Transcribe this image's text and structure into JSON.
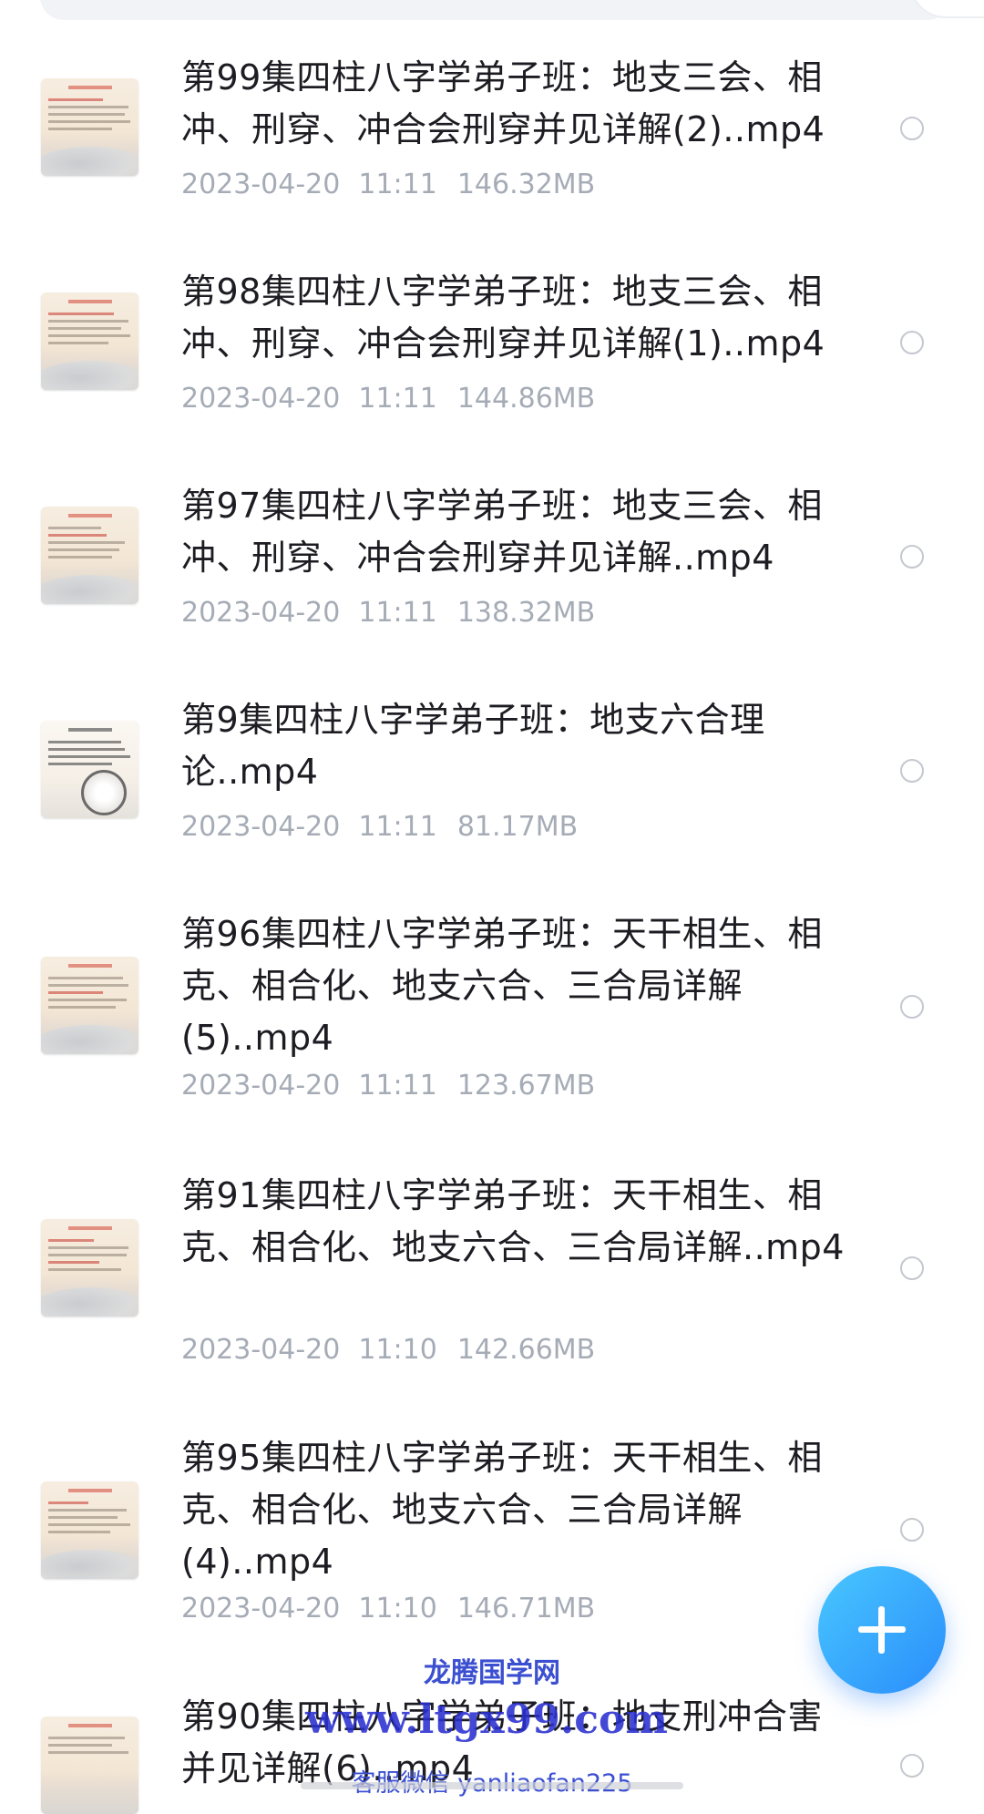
{
  "files": [
    {
      "title": "第99集四柱八字学弟子班：地支三会、相冲、刑穿、冲合会刑穿并见详解(2)..mp4",
      "date": "2023-04-20",
      "time": "11:11",
      "size": "146.32MB"
    },
    {
      "title": "第98集四柱八字学弟子班：地支三会、相冲、刑穿、冲合会刑穿并见详解(1)..mp4",
      "date": "2023-04-20",
      "time": "11:11",
      "size": "144.86MB"
    },
    {
      "title": "第97集四柱八字学弟子班：地支三会、相冲、刑穿、冲合会刑穿并见详解..mp4",
      "date": "2023-04-20",
      "time": "11:11",
      "size": "138.32MB"
    },
    {
      "title": "第9集四柱八字学弟子班：地支六合理论..mp4",
      "date": "2023-04-20",
      "time": "11:11",
      "size": "81.17MB"
    },
    {
      "title": "第96集四柱八字学弟子班：天干相生、相克、相合化、地支六合、三合局详解(5)..mp4",
      "date": "2023-04-20",
      "time": "11:11",
      "size": "123.67MB"
    },
    {
      "title": "第91集四柱八字学弟子班：天干相生、相克、相合化、地支六合、三合局详解..mp4",
      "date": "2023-04-20",
      "time": "11:10",
      "size": "142.66MB"
    },
    {
      "title": "第95集四柱八字学弟子班：天干相生、相克、相合化、地支六合、三合局详解(4)..mp4",
      "date": "2023-04-20",
      "time": "11:10",
      "size": "146.71MB"
    },
    {
      "title": "第90集四柱八字学弟子班：地支刑冲合害并见详解(6)..mp4"
    }
  ],
  "watermark": {
    "name": "龙腾国学网",
    "url": "www.ltgx99.com",
    "contact": "客服微信 yanliaofan225"
  },
  "icons": {
    "fab": "plus-icon",
    "select": "radio-circle-icon",
    "thumbnail": "video-thumbnail"
  },
  "colors": {
    "fab_gradient_start": "#49c7ff",
    "fab_gradient_end": "#2a8dfb",
    "meta_text": "#a6acb6",
    "title_text": "#1c1c22",
    "watermark": "#2a2fd0"
  }
}
